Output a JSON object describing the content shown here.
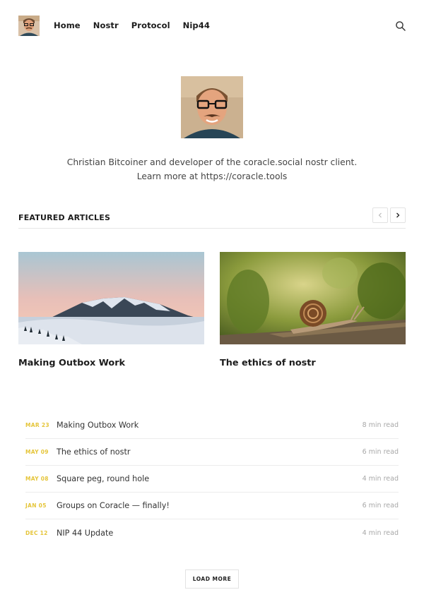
{
  "header": {
    "nav": [
      "Home",
      "Nostr",
      "Protocol",
      "Nip44"
    ],
    "search_icon": "search-icon"
  },
  "hero": {
    "bio_line1": "Christian Bitcoiner and developer of the coracle.social nostr client.",
    "bio_line2": "Learn more at https://coracle.tools"
  },
  "featured": {
    "heading": "FEATURED ARTICLES",
    "prev_icon": "chevron-left-icon",
    "next_icon": "chevron-right-icon",
    "cards": [
      {
        "title": "Making Outbox Work",
        "image": "snowy-mountain-above-clouds"
      },
      {
        "title": "The ethics of nostr",
        "image": "snail-on-wood"
      }
    ]
  },
  "articles": [
    {
      "date": "MAR 23",
      "title": "Making Outbox Work",
      "read": "8 min read"
    },
    {
      "date": "MAY 09",
      "title": "The ethics of nostr",
      "read": "6 min read"
    },
    {
      "date": "MAY 08",
      "title": "Square peg, round hole",
      "read": "4 min read"
    },
    {
      "date": "JAN 05",
      "title": "Groups on Coracle — finally!",
      "read": "6 min read"
    },
    {
      "date": "DEC 12",
      "title": "NIP 44 Update",
      "read": "4 min read"
    }
  ],
  "load_more": "LOAD MORE",
  "colors": {
    "accent": "#e5c53a",
    "text": "#1c1c1c",
    "muted": "#a8a8a8"
  }
}
